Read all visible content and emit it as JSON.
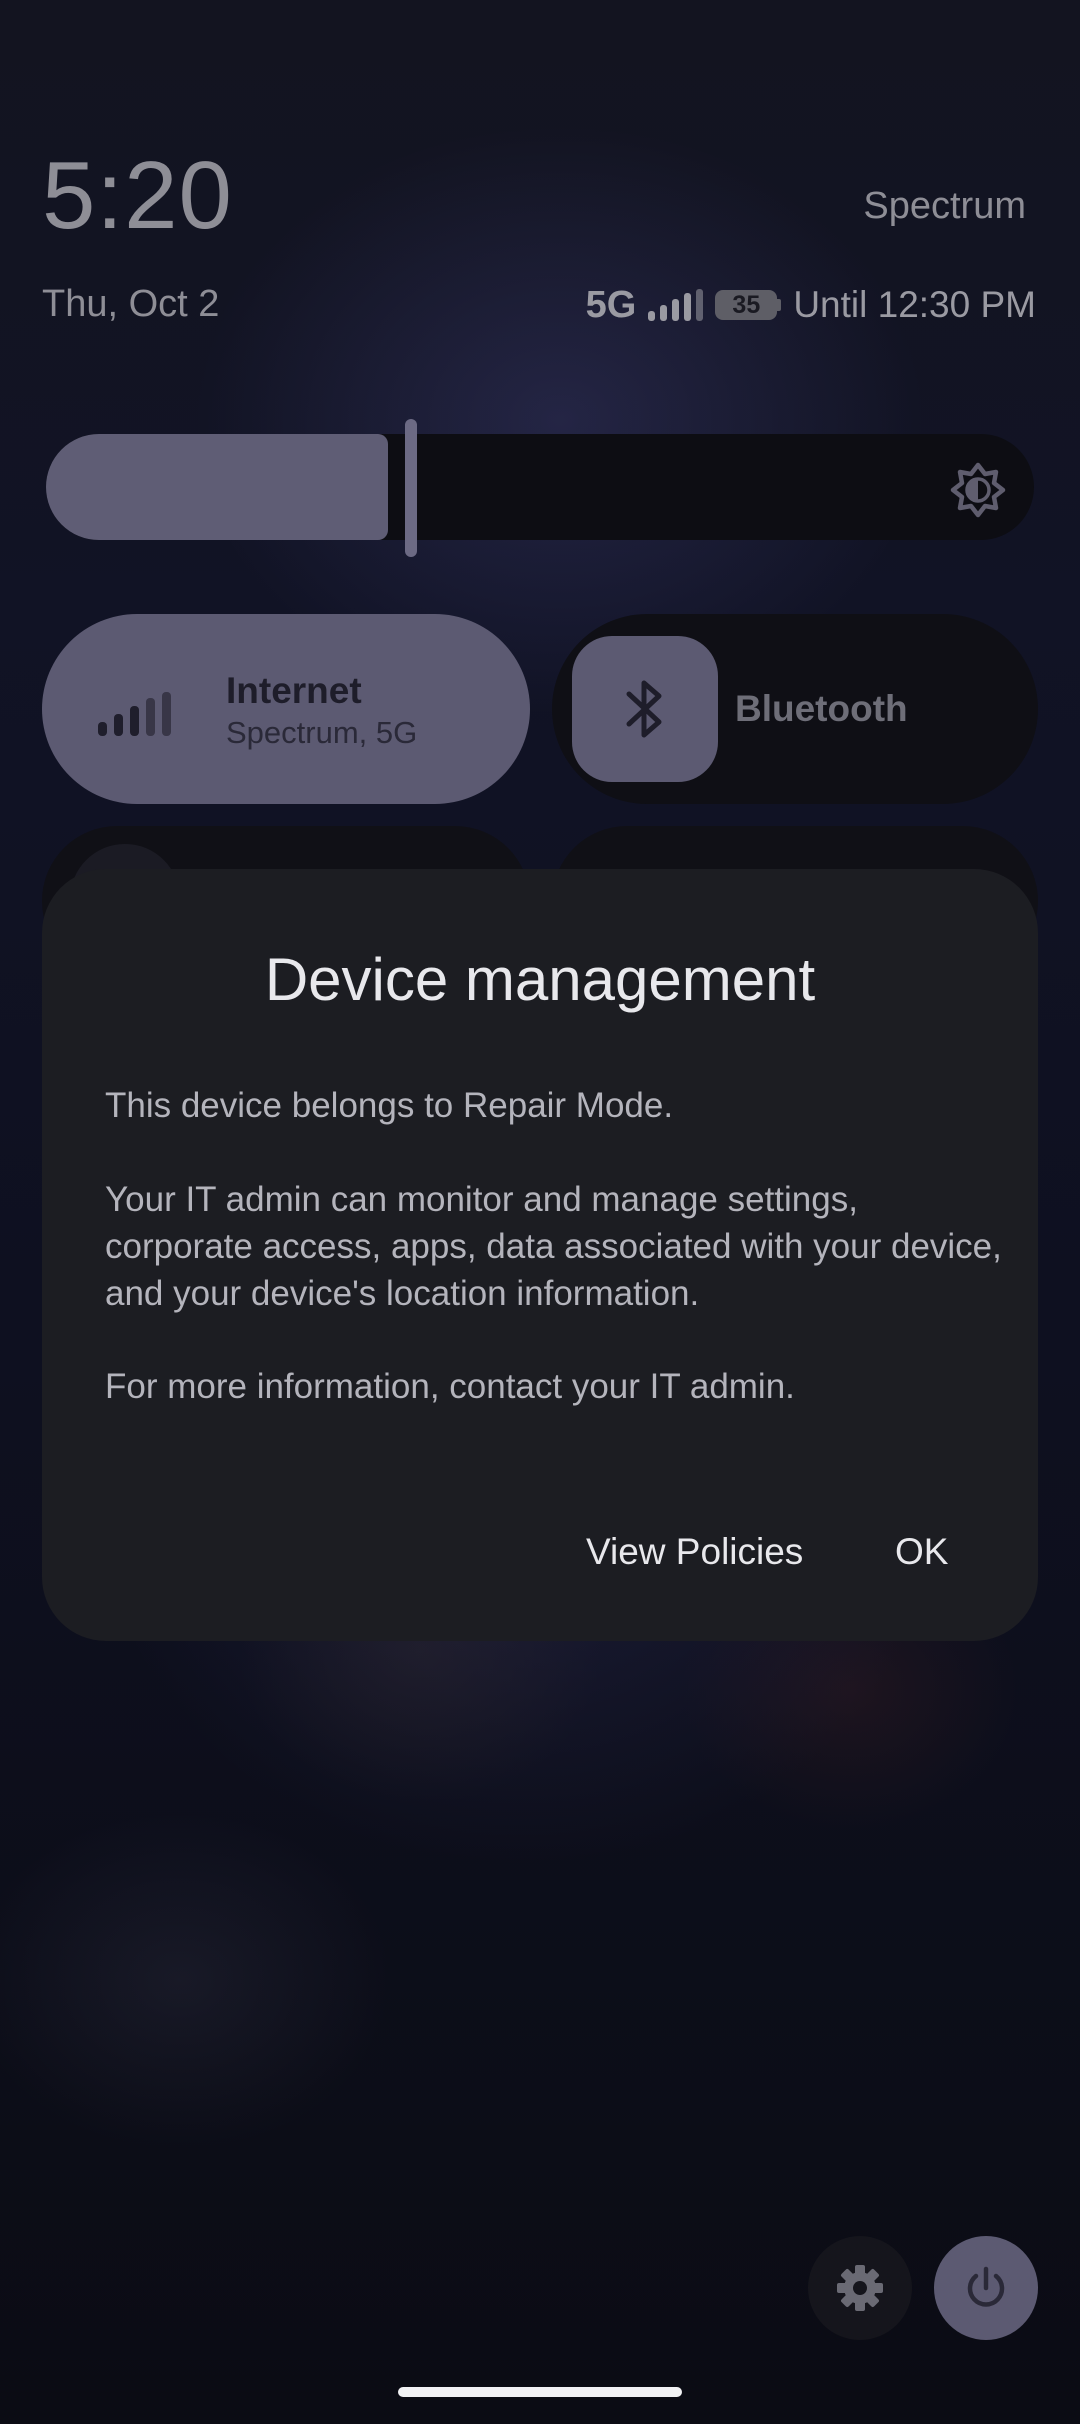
{
  "status_bar": {
    "time": "5:20",
    "date": "Thu, Oct 2",
    "carrier": "Spectrum",
    "network_type": "5G",
    "battery_percent": "35",
    "battery_status": "Until 12:30 PM"
  },
  "quick_settings": {
    "brightness_level": 0.35,
    "tiles": [
      {
        "title": "Internet",
        "subtitle": "Spectrum, 5G",
        "state": "on"
      },
      {
        "title": "Bluetooth",
        "subtitle": "",
        "state": "off"
      }
    ]
  },
  "dialog": {
    "title": "Device management",
    "paragraphs": [
      "This device belongs to Repair Mode.",
      "Your IT admin can monitor and manage settings, corporate access, apps, data associated with your device, and your device's location information.",
      "For more information, contact your IT admin."
    ],
    "buttons": {
      "view_policies": "View Policies",
      "ok": "OK"
    }
  },
  "icons": {
    "brightness": "brightness-auto-icon",
    "internet": "cellular-signal-icon",
    "bluetooth": "bluetooth-icon",
    "settings": "gear-icon",
    "power": "power-icon"
  },
  "colors": {
    "tile_active": "#5c5a72",
    "dialog_bg": "#1c1d22",
    "accent_text": "#e8e8ec"
  }
}
